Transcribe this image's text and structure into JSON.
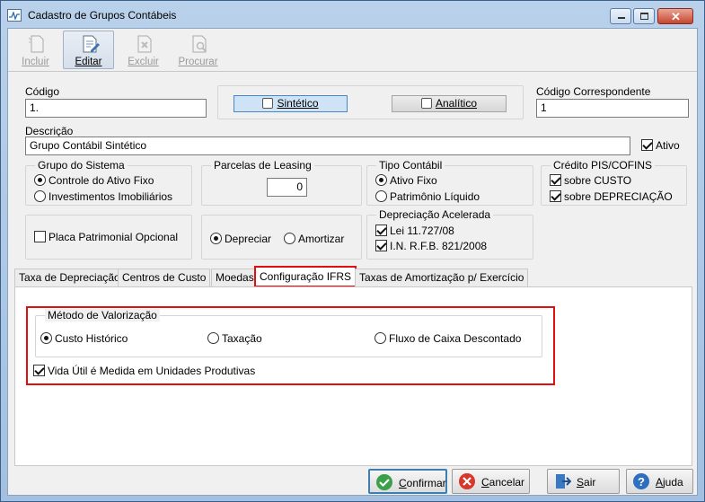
{
  "window": {
    "title": "Cadastro de Grupos Contábeis"
  },
  "toolbar": {
    "buttons": [
      {
        "label": "Incluir",
        "enabled": false,
        "icon": "new-document-icon"
      },
      {
        "label": "Editar",
        "enabled": true,
        "icon": "edit-document-icon"
      },
      {
        "label": "Excluir",
        "enabled": false,
        "icon": "delete-document-icon"
      },
      {
        "label": "Procurar",
        "enabled": false,
        "icon": "search-document-icon"
      }
    ]
  },
  "form": {
    "codigo_label": "Código",
    "codigo_value": "1.",
    "sintetico_label": "Sintético",
    "analitico_label": "Analítico",
    "codigo_corresp_label": "Código Correspondente",
    "codigo_corresp_value": "1",
    "descricao_label": "Descrição",
    "descricao_value": "Grupo Contábil Sintético",
    "ativo_label": "Ativo",
    "grupo_sistema": {
      "title": "Grupo do Sistema",
      "opt1": "Controle do Ativo Fixo",
      "opt2": "Investimentos Imobiliários"
    },
    "parcelas": {
      "title": "Parcelas de Leasing",
      "value": "0"
    },
    "tipo_contabil": {
      "title": "Tipo Contábil",
      "opt1": "Ativo Fixo",
      "opt2": "Patrimônio Líquido"
    },
    "credito": {
      "title": "Crédito PIS/COFINS",
      "opt1": "sobre CUSTO",
      "opt2": "sobre DEPRECIAÇÃO"
    },
    "placa_label": "Placa Patrimonial Opcional",
    "depreciar_label": "Depreciar",
    "amortizar_label": "Amortizar",
    "dep_acel": {
      "title": "Depreciação Acelerada",
      "opt1": "Lei 11.727/08",
      "opt2": "I.N. R.F.B. 821/2008"
    }
  },
  "tabs": [
    "Taxa de Depreciação",
    "Centros de Custo",
    "Moedas",
    "Configuração IFRS",
    "Taxas de Amortização p/ Exercício"
  ],
  "ifrs": {
    "metodo_title": "Método de Valorização",
    "opt1": "Custo Histórico",
    "opt2": "Taxação",
    "opt3": "Fluxo de Caixa Descontado",
    "vida_util_label": "Vida Útil é Medida em Unidades Produtivas"
  },
  "footer": {
    "confirmar": "Confirmar",
    "cancelar": "Cancelar",
    "sair": "Sair",
    "ajuda": "Ajuda"
  },
  "colors": {
    "highlight": "#e01010",
    "accent": "#3c7fb1"
  }
}
